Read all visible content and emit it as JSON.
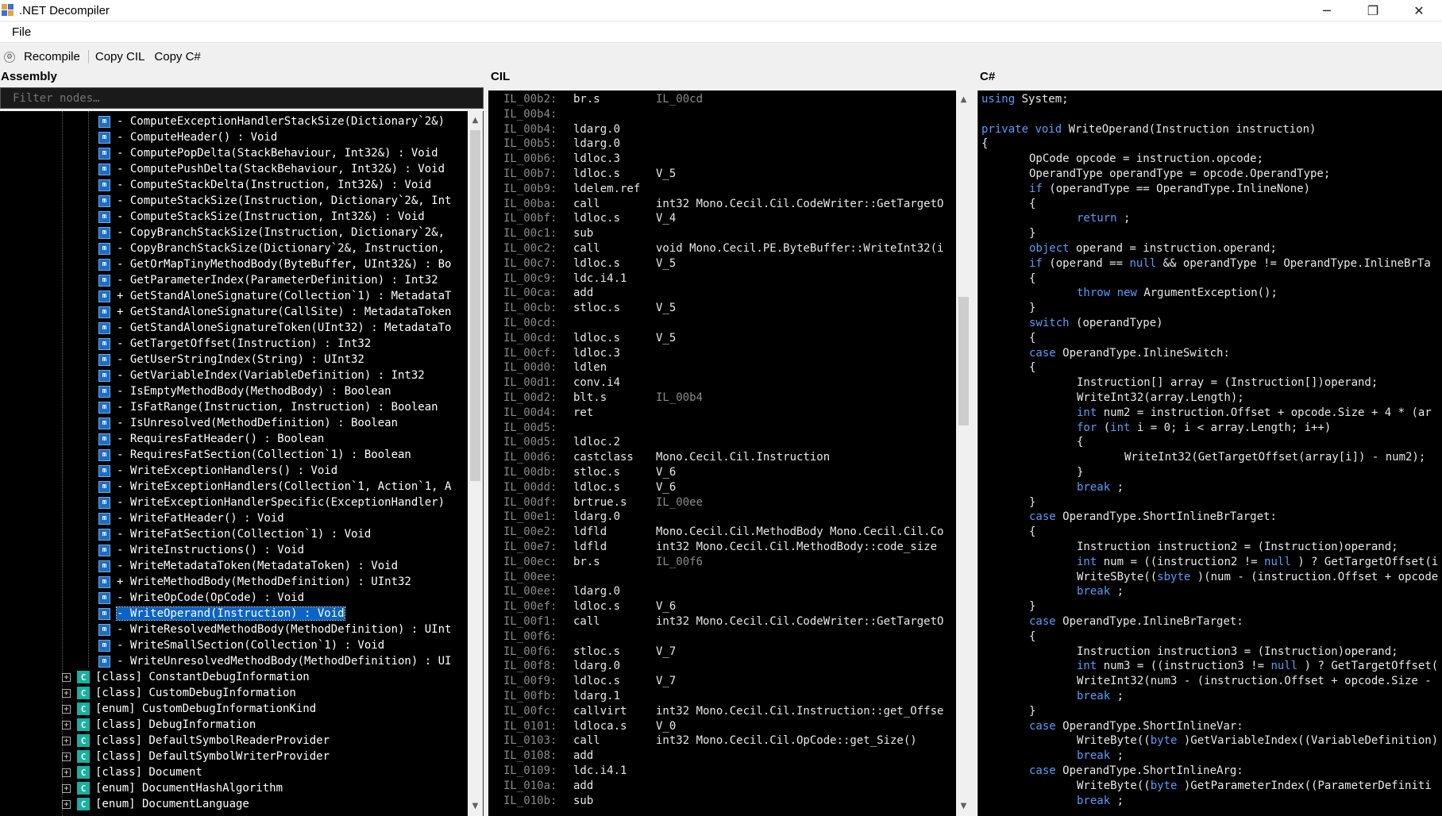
{
  "window": {
    "title": ".NET Decompiler",
    "minimize": "─",
    "maximize": "❐",
    "close": "✕"
  },
  "menu": {
    "file": "File"
  },
  "toolbar": {
    "recompile": "Recompile",
    "copy_cil": "Copy CIL",
    "copy_cs": "Copy C#"
  },
  "panes": {
    "assembly": "Assembly",
    "cil": "CIL",
    "cs": "C#"
  },
  "filter": {
    "placeholder": "Filter nodes…"
  },
  "tree_methods": [
    {
      "prefix": "-",
      "text": "ComputeExceptionHandlerStackSize(Dictionary`2&)"
    },
    {
      "prefix": "-",
      "text": "ComputeHeader() : Void"
    },
    {
      "prefix": "-",
      "text": "ComputePopDelta(StackBehaviour, Int32&) : Void"
    },
    {
      "prefix": "-",
      "text": "ComputePushDelta(StackBehaviour, Int32&) : Void"
    },
    {
      "prefix": "-",
      "text": "ComputeStackDelta(Instruction, Int32&) : Void"
    },
    {
      "prefix": "-",
      "text": "ComputeStackSize(Instruction, Dictionary`2&, Int"
    },
    {
      "prefix": "-",
      "text": "ComputeStackSize(Instruction, Int32&) : Void"
    },
    {
      "prefix": "-",
      "text": "CopyBranchStackSize(Instruction, Dictionary`2&,"
    },
    {
      "prefix": "-",
      "text": "CopyBranchStackSize(Dictionary`2&, Instruction,"
    },
    {
      "prefix": "-",
      "text": "GetOrMapTinyMethodBody(ByteBuffer, UInt32&) : Bo"
    },
    {
      "prefix": "-",
      "text": "GetParameterIndex(ParameterDefinition) : Int32"
    },
    {
      "prefix": "+",
      "text": "GetStandAloneSignature(Collection`1) : MetadataT"
    },
    {
      "prefix": "+",
      "text": "GetStandAloneSignature(CallSite) : MetadataToken"
    },
    {
      "prefix": "-",
      "text": "GetStandAloneSignatureToken(UInt32) : MetadataTo"
    },
    {
      "prefix": "-",
      "text": "GetTargetOffset(Instruction) : Int32"
    },
    {
      "prefix": "-",
      "text": "GetUserStringIndex(String) : UInt32"
    },
    {
      "prefix": "-",
      "text": "GetVariableIndex(VariableDefinition) : Int32"
    },
    {
      "prefix": "-",
      "text": "IsEmptyMethodBody(MethodBody) : Boolean"
    },
    {
      "prefix": "-",
      "text": "IsFatRange(Instruction, Instruction) : Boolean"
    },
    {
      "prefix": "-",
      "text": "IsUnresolved(MethodDefinition) : Boolean"
    },
    {
      "prefix": "-",
      "text": "RequiresFatHeader() : Boolean"
    },
    {
      "prefix": "-",
      "text": "RequiresFatSection(Collection`1) : Boolean"
    },
    {
      "prefix": "-",
      "text": "WriteExceptionHandlers() : Void"
    },
    {
      "prefix": "-",
      "text": "WriteExceptionHandlers(Collection`1, Action`1, A"
    },
    {
      "prefix": "-",
      "text": "WriteExceptionHandlerSpecific(ExceptionHandler)"
    },
    {
      "prefix": "-",
      "text": "WriteFatHeader() : Void"
    },
    {
      "prefix": "-",
      "text": "WriteFatSection(Collection`1) : Void"
    },
    {
      "prefix": "-",
      "text": "WriteInstructions() : Void"
    },
    {
      "prefix": "-",
      "text": "WriteMetadataToken(MetadataToken) : Void"
    },
    {
      "prefix": "+",
      "text": "WriteMethodBody(MethodDefinition) : UInt32"
    },
    {
      "prefix": "-",
      "text": "WriteOpCode(OpCode) : Void"
    },
    {
      "prefix": "-",
      "text": "WriteOperand(Instruction) : Void"
    },
    {
      "prefix": "-",
      "text": "WriteResolvedMethodBody(MethodDefinition) : UInt"
    },
    {
      "prefix": "-",
      "text": "WriteSmallSection(Collection`1) : Void"
    },
    {
      "prefix": "-",
      "text": "WriteUnresolvedMethodBody(MethodDefinition) : UI"
    }
  ],
  "tree_types": [
    "[class] ConstantDebugInformation",
    "[class] CustomDebugInformation",
    "[enum] CustomDebugInformationKind",
    "[class] DebugInformation",
    "[class] DefaultSymbolReaderProvider",
    "[class] DefaultSymbolWriterProvider",
    "[class] Document",
    "[enum] DocumentHashAlgorithm",
    "[enum] DocumentLanguage"
  ],
  "cil": [
    [
      "IL_00b2:",
      "br.s",
      "IL_00cd",
      true
    ],
    [
      "IL_00b4:",
      "",
      "",
      false
    ],
    [
      "IL_00b4:",
      "ldarg.0",
      "",
      false
    ],
    [
      "IL_00b5:",
      "ldarg.0",
      "",
      false
    ],
    [
      "IL_00b6:",
      "ldloc.3",
      "",
      false
    ],
    [
      "IL_00b7:",
      "ldloc.s",
      "V_5",
      false
    ],
    [
      "IL_00b9:",
      "ldelem.ref",
      "",
      false
    ],
    [
      "IL_00ba:",
      "call",
      "int32 Mono.Cecil.Cil.CodeWriter::GetTargetO",
      false
    ],
    [
      "IL_00bf:",
      "ldloc.s",
      "V_4",
      false
    ],
    [
      "IL_00c1:",
      "sub",
      "",
      false
    ],
    [
      "IL_00c2:",
      "call",
      "void Mono.Cecil.PE.ByteBuffer::WriteInt32(i",
      false
    ],
    [
      "IL_00c7:",
      "ldloc.s",
      "V_5",
      false
    ],
    [
      "IL_00c9:",
      "ldc.i4.1",
      "",
      false
    ],
    [
      "IL_00ca:",
      "add",
      "",
      false
    ],
    [
      "IL_00cb:",
      "stloc.s",
      "V_5",
      false
    ],
    [
      "IL_00cd:",
      "",
      "",
      false
    ],
    [
      "IL_00cd:",
      "ldloc.s",
      "V_5",
      false
    ],
    [
      "IL_00cf:",
      "ldloc.3",
      "",
      false
    ],
    [
      "IL_00d0:",
      "ldlen",
      "",
      false
    ],
    [
      "IL_00d1:",
      "conv.i4",
      "",
      false
    ],
    [
      "IL_00d2:",
      "blt.s",
      "IL_00b4",
      true
    ],
    [
      "IL_00d4:",
      "ret",
      "",
      false
    ],
    [
      "IL_00d5:",
      "",
      "",
      false
    ],
    [
      "IL_00d5:",
      "ldloc.2",
      "",
      false
    ],
    [
      "IL_00d6:",
      "castclass",
      "Mono.Cecil.Cil.Instruction",
      false
    ],
    [
      "IL_00db:",
      "stloc.s",
      "V_6",
      false
    ],
    [
      "IL_00dd:",
      "ldloc.s",
      "V_6",
      false
    ],
    [
      "IL_00df:",
      "brtrue.s",
      "IL_00ee",
      true
    ],
    [
      "IL_00e1:",
      "ldarg.0",
      "",
      false
    ],
    [
      "IL_00e2:",
      "ldfld",
      "Mono.Cecil.Cil.MethodBody Mono.Cecil.Cil.Co",
      false
    ],
    [
      "IL_00e7:",
      "ldfld",
      "int32 Mono.Cecil.Cil.MethodBody::code_size",
      false
    ],
    [
      "IL_00ec:",
      "br.s",
      "IL_00f6",
      true
    ],
    [
      "IL_00ee:",
      "",
      "",
      false
    ],
    [
      "IL_00ee:",
      "ldarg.0",
      "",
      false
    ],
    [
      "IL_00ef:",
      "ldloc.s",
      "V_6",
      false
    ],
    [
      "IL_00f1:",
      "call",
      "int32 Mono.Cecil.Cil.CodeWriter::GetTargetO",
      false
    ],
    [
      "IL_00f6:",
      "",
      "",
      false
    ],
    [
      "IL_00f6:",
      "stloc.s",
      "V_7",
      false
    ],
    [
      "IL_00f8:",
      "ldarg.0",
      "",
      false
    ],
    [
      "IL_00f9:",
      "ldloc.s",
      "V_7",
      false
    ],
    [
      "IL_00fb:",
      "ldarg.1",
      "",
      false
    ],
    [
      "IL_00fc:",
      "callvirt",
      "int32 Mono.Cecil.Cil.Instruction::get_Offse",
      false
    ],
    [
      "IL_0101:",
      "ldloca.s",
      "V_0",
      false
    ],
    [
      "IL_0103:",
      "call",
      "int32 Mono.Cecil.Cil.OpCode::get_Size()",
      false
    ],
    [
      "IL_0108:",
      "add",
      "",
      false
    ],
    [
      "IL_0109:",
      "ldc.i4.1",
      "",
      false
    ],
    [
      "IL_010a:",
      "add",
      "",
      false
    ],
    [
      "IL_010b:",
      "sub",
      "",
      false
    ]
  ],
  "cs": [
    [
      0,
      [
        [
          "kw",
          "using"
        ],
        [
          "",
          "System;"
        ]
      ]
    ],
    [
      0,
      []
    ],
    [
      0,
      [
        [
          "kw",
          "private"
        ],
        [
          "",
          ""
        ],
        [
          "kw",
          "void"
        ],
        [
          "",
          "WriteOperand(Instruction instruction)"
        ]
      ]
    ],
    [
      0,
      [
        [
          "",
          "{"
        ]
      ]
    ],
    [
      1,
      [
        [
          "",
          "OpCode opcode = instruction.opcode;"
        ]
      ]
    ],
    [
      1,
      [
        [
          "",
          "OperandType operandType = opcode.OperandType;"
        ]
      ]
    ],
    [
      1,
      [
        [
          "kw",
          "if"
        ],
        [
          "",
          "(operandType == OperandType.InlineNone)"
        ]
      ]
    ],
    [
      1,
      [
        [
          "",
          "{"
        ]
      ]
    ],
    [
      2,
      [
        [
          "kw",
          "return"
        ],
        [
          "",
          ";"
        ]
      ]
    ],
    [
      1,
      [
        [
          "",
          "}"
        ]
      ]
    ],
    [
      1,
      [
        [
          "kw",
          "object"
        ],
        [
          "",
          "operand = instruction.operand;"
        ]
      ]
    ],
    [
      1,
      [
        [
          "kw",
          "if"
        ],
        [
          "",
          "(operand == "
        ],
        [
          "kw",
          "null"
        ],
        [
          "",
          "&& operandType != OperandType.InlineBrTa"
        ]
      ]
    ],
    [
      1,
      [
        [
          "",
          "{"
        ]
      ]
    ],
    [
      2,
      [
        [
          "kw",
          "throw"
        ],
        [
          "",
          ""
        ],
        [
          "kw",
          "new"
        ],
        [
          "",
          "ArgumentException();"
        ]
      ]
    ],
    [
      1,
      [
        [
          "",
          "}"
        ]
      ]
    ],
    [
      1,
      [
        [
          "kw",
          "switch"
        ],
        [
          "",
          "(operandType)"
        ]
      ]
    ],
    [
      1,
      [
        [
          "",
          "{"
        ]
      ]
    ],
    [
      1,
      [
        [
          "kw",
          "case"
        ],
        [
          "",
          "OperandType.InlineSwitch:"
        ]
      ]
    ],
    [
      1,
      [
        [
          "",
          "{"
        ]
      ]
    ],
    [
      2,
      [
        [
          "",
          "Instruction[] array = (Instruction[])operand;"
        ]
      ]
    ],
    [
      2,
      [
        [
          "",
          "WriteInt32(array.Length);"
        ]
      ]
    ],
    [
      2,
      [
        [
          "kw",
          "int"
        ],
        [
          "",
          "num2 = instruction.Offset + opcode.Size + 4 * (ar"
        ]
      ]
    ],
    [
      2,
      [
        [
          "kw",
          "for"
        ],
        [
          "",
          "("
        ],
        [
          "kw",
          "int"
        ],
        [
          "",
          "i = 0; i < array.Length; i++)"
        ]
      ]
    ],
    [
      2,
      [
        [
          "",
          "{"
        ]
      ]
    ],
    [
      3,
      [
        [
          "",
          "WriteInt32(GetTargetOffset(array[i]) - num2);"
        ]
      ]
    ],
    [
      2,
      [
        [
          "",
          "}"
        ]
      ]
    ],
    [
      2,
      [
        [
          "kw",
          "break"
        ],
        [
          "",
          ";"
        ]
      ]
    ],
    [
      1,
      [
        [
          "",
          "}"
        ]
      ]
    ],
    [
      1,
      [
        [
          "kw",
          "case"
        ],
        [
          "",
          "OperandType.ShortInlineBrTarget:"
        ]
      ]
    ],
    [
      1,
      [
        [
          "",
          "{"
        ]
      ]
    ],
    [
      2,
      [
        [
          "",
          "Instruction instruction2 = (Instruction)operand;"
        ]
      ]
    ],
    [
      2,
      [
        [
          "kw",
          "int"
        ],
        [
          "",
          "num = ((instruction2 != "
        ],
        [
          "kw",
          "null"
        ],
        [
          "",
          ") ? GetTargetOffset(i"
        ]
      ]
    ],
    [
      2,
      [
        [
          "",
          "WriteSByte(("
        ],
        [
          "kw",
          "sbyte"
        ],
        [
          "",
          ")(num - (instruction.Offset + opcode"
        ]
      ]
    ],
    [
      2,
      [
        [
          "kw",
          "break"
        ],
        [
          "",
          ";"
        ]
      ]
    ],
    [
      1,
      [
        [
          "",
          "}"
        ]
      ]
    ],
    [
      1,
      [
        [
          "kw",
          "case"
        ],
        [
          "",
          "OperandType.InlineBrTarget:"
        ]
      ]
    ],
    [
      1,
      [
        [
          "",
          "{"
        ]
      ]
    ],
    [
      2,
      [
        [
          "",
          "Instruction instruction3 = (Instruction)operand;"
        ]
      ]
    ],
    [
      2,
      [
        [
          "kw",
          "int"
        ],
        [
          "",
          "num3 = ((instruction3 != "
        ],
        [
          "kw",
          "null"
        ],
        [
          "",
          ") ? GetTargetOffset("
        ]
      ]
    ],
    [
      2,
      [
        [
          "",
          "WriteInt32(num3 - (instruction.Offset + opcode.Size -"
        ]
      ]
    ],
    [
      2,
      [
        [
          "kw",
          "break"
        ],
        [
          "",
          ";"
        ]
      ]
    ],
    [
      1,
      [
        [
          "",
          "}"
        ]
      ]
    ],
    [
      1,
      [
        [
          "kw",
          "case"
        ],
        [
          "",
          "OperandType.ShortInlineVar:"
        ]
      ]
    ],
    [
      2,
      [
        [
          "",
          "WriteByte(("
        ],
        [
          "kw",
          "byte"
        ],
        [
          "",
          ")GetVariableIndex((VariableDefinition)"
        ]
      ]
    ],
    [
      2,
      [
        [
          "kw",
          "break"
        ],
        [
          "",
          ";"
        ]
      ]
    ],
    [
      1,
      [
        [
          "kw",
          "case"
        ],
        [
          "",
          "OperandType.ShortInlineArg:"
        ]
      ]
    ],
    [
      2,
      [
        [
          "",
          "WriteByte(("
        ],
        [
          "kw",
          "byte"
        ],
        [
          "",
          ")GetParameterIndex((ParameterDefiniti"
        ]
      ]
    ],
    [
      2,
      [
        [
          "kw",
          "break"
        ],
        [
          "",
          ";"
        ]
      ]
    ]
  ],
  "colors": {
    "keyword": "#5a9cf8",
    "selection": "#0a64c8",
    "method_icon": "#1b6ec2",
    "class_icon": "#18b0a0"
  }
}
